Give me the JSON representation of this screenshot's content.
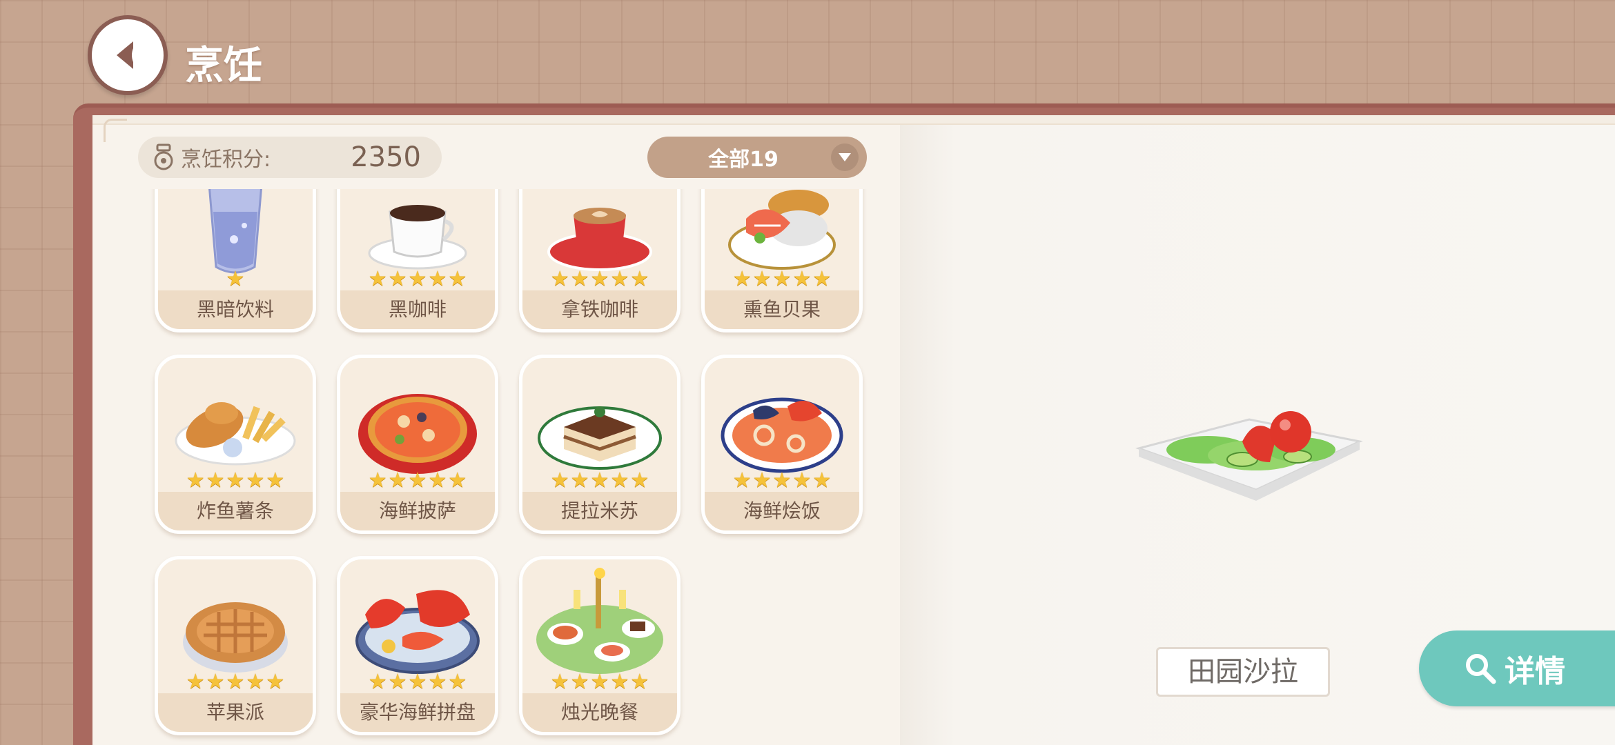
{
  "header": {
    "title": "烹饪"
  },
  "score": {
    "label": "烹饪积分:",
    "value": "2350"
  },
  "filter": {
    "label": "全部19"
  },
  "recipes": [
    {
      "name": "黑暗饮料",
      "stars": 1
    },
    {
      "name": "黑咖啡",
      "stars": 5
    },
    {
      "name": "拿铁咖啡",
      "stars": 5
    },
    {
      "name": "熏鱼贝果",
      "stars": 5
    },
    {
      "name": "炸鱼薯条",
      "stars": 5
    },
    {
      "name": "海鲜披萨",
      "stars": 5
    },
    {
      "name": "提拉米苏",
      "stars": 5
    },
    {
      "name": "海鲜烩饭",
      "stars": 5
    },
    {
      "name": "苹果派",
      "stars": 5
    },
    {
      "name": "豪华海鲜拼盘",
      "stars": 5
    },
    {
      "name": "烛光晚餐",
      "stars": 5
    }
  ],
  "selected": {
    "name": "田园沙拉"
  },
  "detail_button": {
    "label": "详情"
  },
  "colors": {
    "accent": "#6ec8bd",
    "frame": "#a9695f",
    "star": "#f5c23a"
  }
}
